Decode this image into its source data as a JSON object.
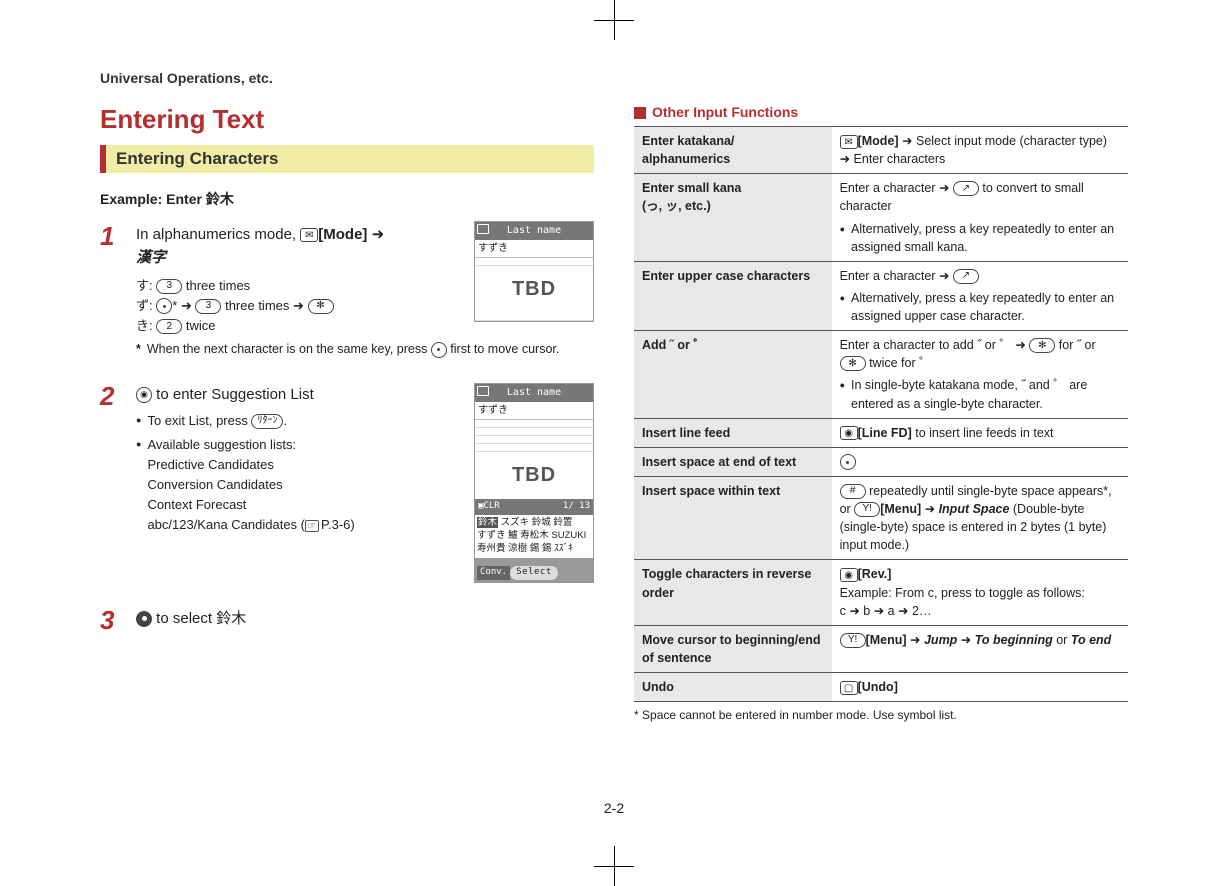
{
  "header": "Universal Operations, etc.",
  "title": "Entering Text",
  "section_band": "Entering Characters",
  "example_label": "Example: Enter 鈴木",
  "steps": {
    "s1": {
      "num": "1",
      "line1_a": "In alphanumerics mode, ",
      "line1_mode": "[Mode]",
      "line1_arrow": " ➜ ",
      "line1_kanji": "漢字",
      "su_label": "す:",
      "su_key": "3",
      "su_text": " three times",
      "zu_label": "ず:",
      "zu_asterisk": "*",
      "zu_arrow": " ➜ ",
      "zu_key": "3",
      "zu_text": " three times ➜ ",
      "zu_star": "✻",
      "ki_label": "き:",
      "ki_key": "2",
      "ki_text": " twice",
      "note": "When the next character is on the same key, press ",
      "note_tail": " first to move cursor."
    },
    "s2": {
      "num": "2",
      "title_tail": " to enter Suggestion List",
      "b1": "To exit List, press ",
      "b1_key": "ﾘﾀｰﾝ",
      "b1_tail": ".",
      "b2": "Available suggestion lists:",
      "l1": "Predictive Candidates",
      "l2": "Conversion Candidates",
      "l3": "Context Forecast",
      "l4_a": "abc/123/Kana Candidates (",
      "l4_b": "P.3-6)"
    },
    "s3": {
      "num": "3",
      "tail": " to select 鈴木"
    }
  },
  "screens": {
    "a": {
      "title": "Last name",
      "input": "すずき",
      "tbd": "TBD"
    },
    "b": {
      "title": "Last name",
      "input": "すずき",
      "tbd": "TBD",
      "status_left": "CLR",
      "status_right": "1/ 13",
      "candidates_line1_hl": "鈴木",
      "candidates_line1": " スズキ 鈴城 鈴置",
      "candidates_line2": "すずき 鱸 寿松木 SUZUKI",
      "candidates_line3": "寿州貴 涼樹 錫 錫 ｽｽﾞｷ",
      "conv": "Conv.",
      "select": "Select"
    }
  },
  "other_h": "Other Input Functions",
  "table": [
    {
      "l": "Enter katakana/\nalphanumerics",
      "r_pre": "",
      "r_mode": "[Mode]",
      "r_mid": " ➜ Select input mode (character type) ➜ Enter characters"
    },
    {
      "l": "Enter small kana\n(っ, ッ, etc.)",
      "r_a": "Enter a character ➜ ",
      "r_b": " to convert to small character",
      "bullet": "Alternatively, press a key repeatedly to enter an assigned small kana."
    },
    {
      "l": "Enter upper case characters",
      "r_a": "Enter a character ➜ ",
      "bullet": "Alternatively, press a key repeatedly to enter an assigned upper case character."
    },
    {
      "l": "Add ˝ or ゜",
      "r_a": "Enter a character to add ˝ or ゜ ➜ ",
      "r_b": " for ˝ or ",
      "r_c": " twice for ゜",
      "bullet": "In single-byte katakana mode, ˝ and ゜ are entered as a single-byte character."
    },
    {
      "l": "Insert line feed",
      "r_mode": "[Line FD]",
      "r_tail": " to insert line feeds in text"
    },
    {
      "l": "Insert space at end of text",
      "r": ""
    },
    {
      "l": "Insert space within text",
      "r_a": " repeatedly until single-byte space appears*, or ",
      "r_menu": "[Menu]",
      "r_arrow": " ➜ ",
      "r_ital": "Input Space",
      "r_tail": " (Double-byte (single-byte) space is entered in 2 bytes (1 byte) input mode.)"
    },
    {
      "l": "Toggle characters in reverse order",
      "r_mode": "[Rev.]",
      "r_ex_label": "Example: From c, press to toggle as follows:",
      "r_ex": "c ➜ b ➜ a ➜ 2…"
    },
    {
      "l": "Move cursor to beginning/end of sentence",
      "r_menu": "[Menu]",
      "r_a": " ➜ ",
      "r_j": "Jump",
      "r_b": " ➜ ",
      "r_tb": "To beginning",
      "r_or": " or ",
      "r_te": "To end"
    },
    {
      "l": "Undo",
      "r_mode": "[Undo]"
    }
  ],
  "footnote": "Space cannot be entered in number mode. Use symbol list.",
  "pagenum": "2-2"
}
